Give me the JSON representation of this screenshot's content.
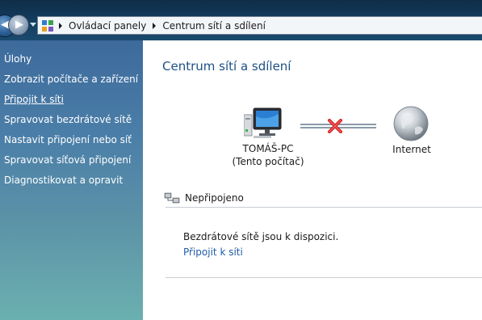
{
  "address_bar": {
    "breadcrumb": [
      "Ovládací panely",
      "Centrum sítí a sdílení"
    ]
  },
  "sidebar": {
    "title": "Úlohy",
    "items": [
      {
        "label": "Zobrazit počítače a zařízení"
      },
      {
        "label": "Připojit k síti"
      },
      {
        "label": "Spravovat bezdrátové sítě"
      },
      {
        "label": "Nastavit připojení nebo síť"
      },
      {
        "label": "Spravovat síťová připojení"
      },
      {
        "label": "Diagnostikovat a opravit"
      }
    ]
  },
  "main": {
    "title": "Centrum sítí a sdílení",
    "network_map": {
      "computer_name": "TOMÁŠ-PC",
      "computer_subtitle": "(Tento počítač)",
      "internet_label": "Internet",
      "connection_state": "broken"
    },
    "status": {
      "label": "Nepřipojeno"
    },
    "wireless_message": "Bezdrátové sítě jsou k dispozici.",
    "connect_link": "Připojit k síti"
  },
  "colors": {
    "sidebar_top": "#3d6a9c",
    "sidebar_bottom": "#6bb0b0",
    "title_blue": "#1e4f86",
    "link_blue": "#1f5ca8",
    "error_red": "#d42020"
  },
  "icons": {
    "computer": "computer-icon",
    "internet": "globe-icon",
    "broken_link": "red-x-icon",
    "network": "network-icon"
  }
}
